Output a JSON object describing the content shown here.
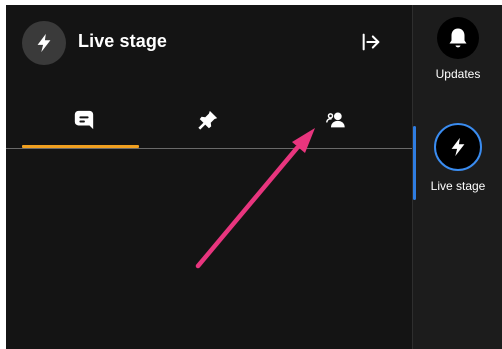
{
  "header": {
    "title": "Live stage",
    "badge_icon": "lightning-icon",
    "exit_icon": "exit-arrow-icon"
  },
  "tabs": [
    {
      "icon": "chat-icon",
      "active": true
    },
    {
      "icon": "pin-icon",
      "active": false
    },
    {
      "icon": "people-icon",
      "active": false
    }
  ],
  "rail": {
    "items": [
      {
        "label": "Updates",
        "icon": "bell-icon",
        "active": false
      },
      {
        "label": "Live stage",
        "icon": "lightning-icon",
        "active": true
      }
    ]
  },
  "colors": {
    "panel_bg": "#141414",
    "rail_bg": "#1c1c1c",
    "tab_active_underline": "#f0a020",
    "rail_active_accent": "#3a8cf0",
    "annotation_arrow": "#e8357e"
  }
}
